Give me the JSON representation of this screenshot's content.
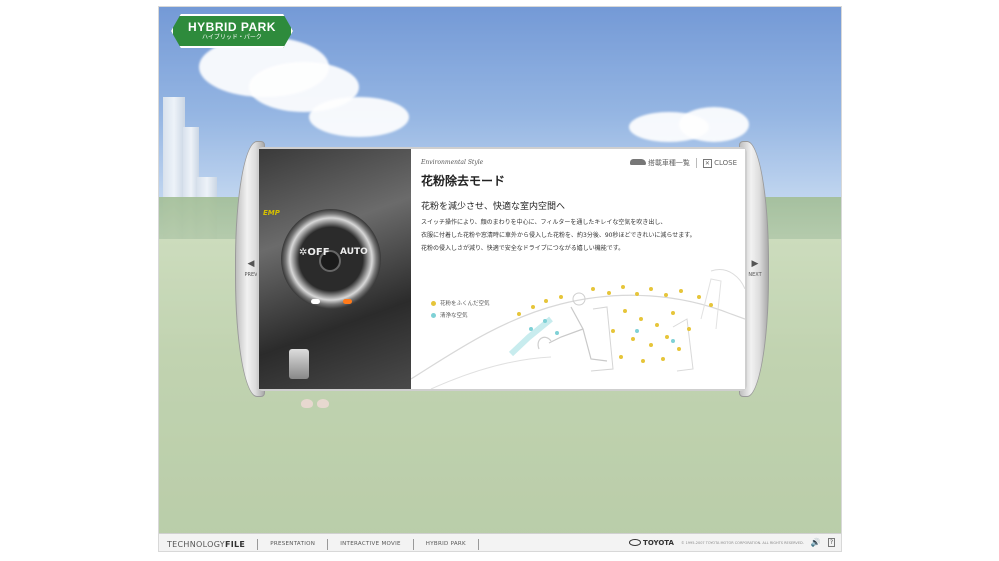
{
  "logo": {
    "title": "HYBRID PARK",
    "subtitle": "ハイブリッド・パーク"
  },
  "modal": {
    "eyebrow": "Environmental Style",
    "title": "花粉除去モード",
    "subtitle": "花粉を減少させ、快適な室内空間へ",
    "body": [
      "スイッチ操作により、顔のまわりを中心に、フィルターを通したキレイな空気を吹き出し、",
      "衣服に付着した花粉や窓清時に車外から侵入した花粉を、約3分後、90秒ほどできれいに減らせます。",
      "花粉の侵入しさが減り、快適で安全なドライブにつながる嬉しい機能です。"
    ],
    "links": {
      "models": "搭載車種一覧",
      "close": "CLOSE"
    },
    "legend": [
      {
        "label": "花粉をふくんだ空気",
        "color": "#e6c53a"
      },
      {
        "label": "清浄な空気",
        "color": "#7fd1d6"
      }
    ],
    "nav": {
      "prev": "PREV",
      "next": "NEXT"
    },
    "photo": {
      "off": "✲OFF",
      "auto": "AUTO",
      "emp": "EMP"
    }
  },
  "footer": {
    "brand_light": "TECHNOLOGY",
    "brand_bold": "FILE",
    "items": [
      "PRESENTATION",
      "INTERACTIVE MOVIE",
      "HYBRID PARK"
    ],
    "maker": "TOYOTA",
    "copyright": "© 1995-2007 TOYOTA MOTOR CORPORATION. ALL RIGHTS RESERVED.",
    "volume": "🔊",
    "help": "?"
  }
}
